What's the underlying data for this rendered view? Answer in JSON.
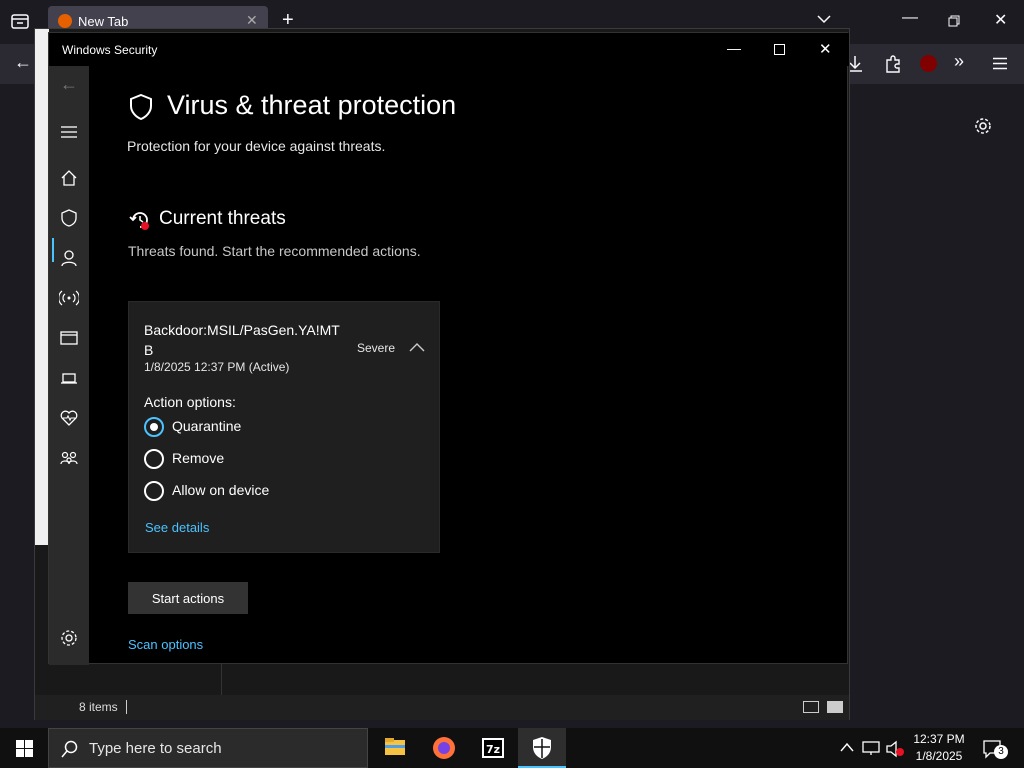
{
  "browser": {
    "tab_title": "New Tab",
    "colors": {
      "tab_bg": "#42414d",
      "toolbar_bg": "#2b2a33",
      "bg": "#1c1b22"
    }
  },
  "explorer": {
    "status_text": "8 items"
  },
  "security_window": {
    "title": "Windows Security",
    "page_title": "Virus & threat protection",
    "page_subtitle": "Protection for your device against threats.",
    "section_title": "Current threats",
    "section_subtitle": "Threats found. Start the recommended actions.",
    "nav_items": [
      "home-icon",
      "shield-icon",
      "account-icon",
      "firewall-icon",
      "app-browser-icon",
      "device-icon",
      "health-icon",
      "family-icon",
      "settings-icon"
    ],
    "threat": {
      "name": "Backdoor:MSIL/PasGen.YA!MTB",
      "severity": "Severe",
      "date": "1/8/2025 12:37 PM (Active)",
      "action_label": "Action options:",
      "options": [
        {
          "label": "Quarantine",
          "selected": true
        },
        {
          "label": "Remove",
          "selected": false
        },
        {
          "label": "Allow on device",
          "selected": false
        }
      ],
      "details_link": "See details"
    },
    "start_button": "Start actions",
    "scan_options_link": "Scan options",
    "accent": "#4cc2ff"
  },
  "taskbar": {
    "search_placeholder": "Type here to search",
    "time": "12:37 PM",
    "date": "1/8/2025",
    "notification_count": "3",
    "apps": [
      "file-explorer-icon",
      "firefox-icon",
      "7zip-icon",
      "windows-security-icon"
    ]
  }
}
